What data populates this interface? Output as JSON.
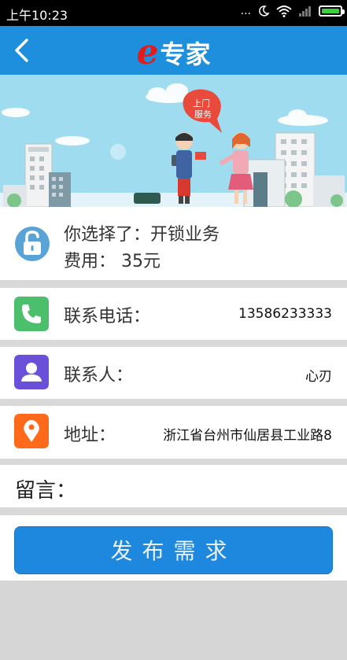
{
  "status_bar": {
    "time": "上午10:23",
    "dots": "...",
    "battery_level": 1.0
  },
  "navbar": {
    "back_icon": "chevron-left-icon",
    "title_letter": "e",
    "title_text": "专家"
  },
  "banner": {
    "badge_line1": "上门",
    "badge_line2": "服务"
  },
  "service": {
    "selected": "你选择了：开锁业务",
    "fee": "费用： 35元",
    "icon": "unlock-icon"
  },
  "contact_phone": {
    "label": "联系电话：",
    "value": "13586233333",
    "icon": "phone-icon"
  },
  "contact_person": {
    "label": "联系人：",
    "value": "心刃",
    "icon": "person-icon"
  },
  "address": {
    "label": "地址：",
    "value": "浙江省台州市仙居县工业路8",
    "icon": "location-pin-icon"
  },
  "message": {
    "label": "留言：",
    "value": ""
  },
  "submit": {
    "label": "发布需求"
  },
  "colors": {
    "primary": "#1e8fdc",
    "logo_red": "#e21c1c",
    "phone_green": "#4cbf6c",
    "person_purple": "#6a4fd8",
    "pin_orange": "#ff6a1a"
  }
}
